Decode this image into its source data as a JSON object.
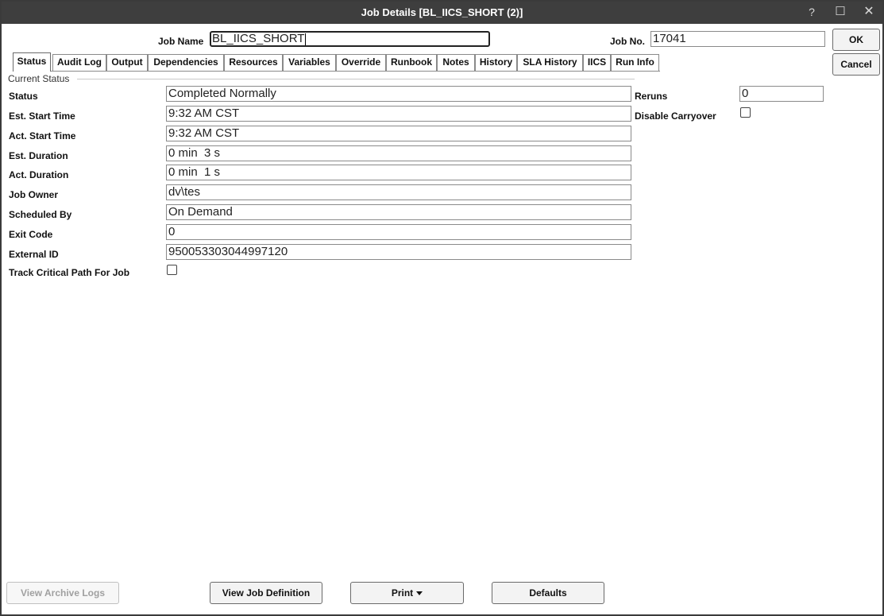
{
  "window": {
    "title": "Job Details [BL_IICS_SHORT (2)]",
    "help_glyph": "?",
    "maximize_glyph": "☐",
    "close_glyph": "✕"
  },
  "header": {
    "job_name_label": "Job Name",
    "job_name_value": "BL_IICS_SHORT",
    "job_no_label": "Job No.",
    "job_no_value": "17041",
    "ok_label": "OK",
    "cancel_label": "Cancel"
  },
  "tabs": [
    {
      "label": "Status",
      "active": true
    },
    {
      "label": "Audit Log"
    },
    {
      "label": "Output"
    },
    {
      "label": "Dependencies"
    },
    {
      "label": "Resources"
    },
    {
      "label": "Variables"
    },
    {
      "label": "Override"
    },
    {
      "label": "Runbook"
    },
    {
      "label": "Notes"
    },
    {
      "label": "History"
    },
    {
      "label": "SLA History"
    },
    {
      "label": "IICS"
    },
    {
      "label": "Run Info"
    }
  ],
  "section_title": "Current Status",
  "fields": {
    "status": {
      "label": "Status",
      "value": "Completed Normally"
    },
    "est_start": {
      "label": "Est. Start Time",
      "value": "9:32 AM CST"
    },
    "act_start": {
      "label": "Act. Start Time",
      "value": "9:32 AM CST"
    },
    "est_duration": {
      "label": "Est. Duration",
      "value": "0 min  3 s"
    },
    "act_duration": {
      "label": "Act. Duration",
      "value": "0 min  1 s"
    },
    "job_owner": {
      "label": "Job Owner",
      "value": "dv\\tes"
    },
    "scheduled_by": {
      "label": "Scheduled By",
      "value": "On Demand"
    },
    "exit_code": {
      "label": "Exit Code",
      "value": "0"
    },
    "external_id": {
      "label": "External ID",
      "value": "950053303044997120"
    },
    "track_critical": {
      "label": "Track Critical Path For Job",
      "checked": false
    }
  },
  "right_fields": {
    "reruns": {
      "label": "Reruns",
      "value": "0"
    },
    "disable_carryover": {
      "label": "Disable Carryover",
      "checked": false
    }
  },
  "footer": {
    "view_archive_logs": "View Archive Logs",
    "view_job_definition": "View Job Definition",
    "print": "Print",
    "defaults": "Defaults"
  }
}
